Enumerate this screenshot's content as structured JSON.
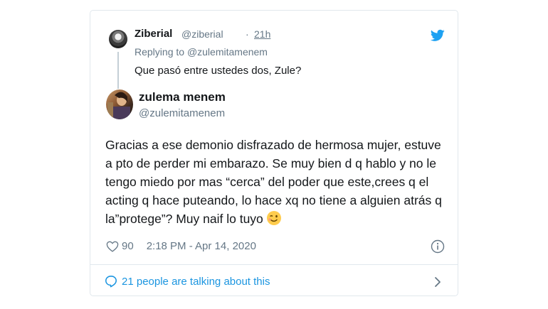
{
  "reply": {
    "name": "Ziberial",
    "handle": "@ziberial",
    "separator": "·",
    "time": "21h",
    "replying_prefix": "Replying to",
    "replying_handle": "@zulemitamenem",
    "text": "Que pasó entre ustedes dos, Zule?"
  },
  "tweet": {
    "name": "zulema menem",
    "handle": "@zulemitamenem",
    "text": "Gracias a ese demonio disfrazado de hermosa mujer, estuve a pto de perder mi embarazo. Se muy bien d q hablo y no le tengo miedo por mas “cerca” del poder que este,crees q el acting q hace puteando, lo hace xq no tiene a alguien atrás q la”protege”? Muy naif lo tuyo",
    "emoji_icon": "winking-face-icon",
    "likes": "90",
    "timestamp": "2:18 PM - Apr 14, 2020"
  },
  "footer": {
    "talking_text": "21 people are talking about this"
  },
  "colors": {
    "twitter_blue": "#1da1f2",
    "link_blue": "#1b95e0",
    "secondary": "#657786",
    "border": "#e1e8ed"
  }
}
